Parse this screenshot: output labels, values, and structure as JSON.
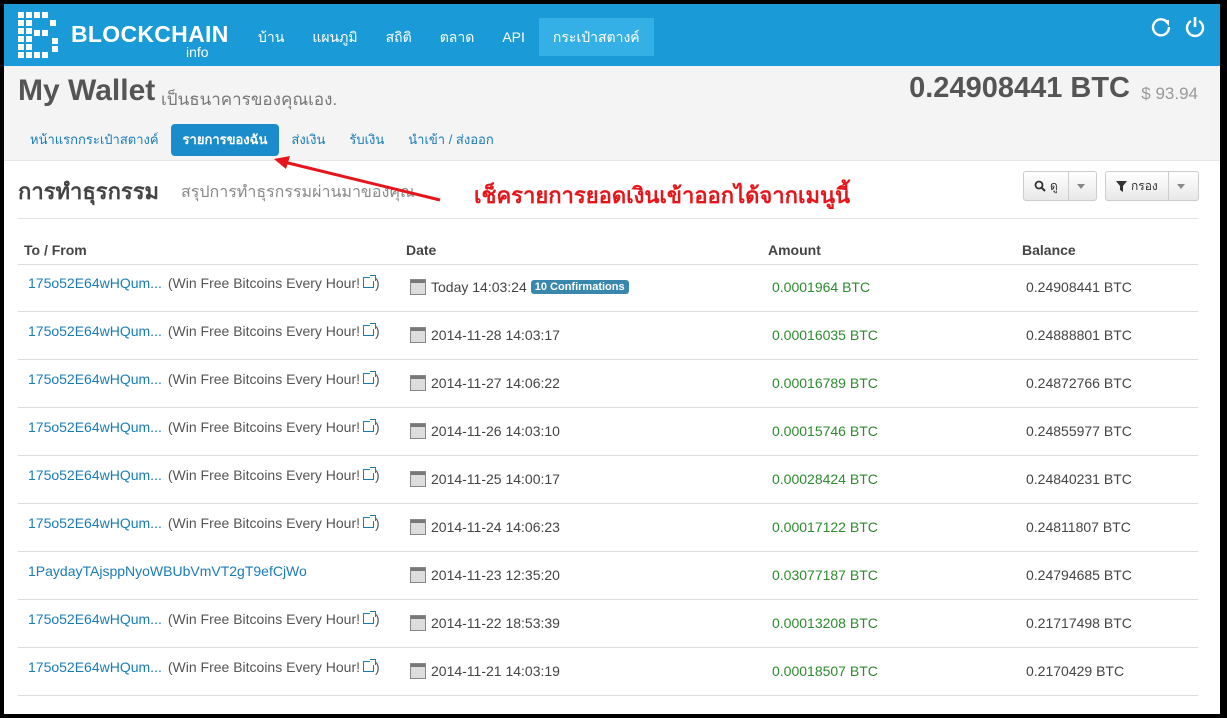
{
  "brand": {
    "name": "BLOCKCHAIN",
    "sub": "info"
  },
  "nav": {
    "items": [
      {
        "label": "บ้าน"
      },
      {
        "label": "แผนภูมิ"
      },
      {
        "label": "สถิติ"
      },
      {
        "label": "ตลาด"
      },
      {
        "label": "API"
      },
      {
        "label": "กระเป๋าสตางค์"
      }
    ],
    "active_index": 5
  },
  "header": {
    "title": "My Wallet",
    "subtitle": "เป็นธนาคารของคุณเอง.",
    "balance": "0.24908441 BTC",
    "usd": "$ 93.94"
  },
  "subnav": {
    "items": [
      {
        "label": "หน้าแรกกระเป๋าสตางค์"
      },
      {
        "label": "รายการของฉัน"
      },
      {
        "label": "ส่งเงิน"
      },
      {
        "label": "รับเงิน"
      },
      {
        "label": "นำเข้า / ส่งออก"
      }
    ],
    "active_index": 1
  },
  "page": {
    "title": "การทำธุรกรรม",
    "subtitle": "สรุปการทำธุรกรรมผ่านมาของคุณ",
    "view_label": "ดู",
    "filter_label": "กรอง"
  },
  "annotation": {
    "text": "เช็ครายการยอดเงินเข้าออกได้จากเมนูนี้",
    "color": "#e5161b"
  },
  "table": {
    "headers": {
      "to_from": "To / From",
      "date": "Date",
      "amount": "Amount",
      "balance": "Balance"
    },
    "rows": [
      {
        "addr": "175o52E64wHQum...",
        "label": "(Win Free Bitcoins Every Hour!",
        "label_end": ")",
        "date": "Today 14:03:24",
        "badge": "10 Confirmations",
        "amount": "0.0001964 BTC",
        "balance": "0.24908441 BTC"
      },
      {
        "addr": "175o52E64wHQum...",
        "label": "(Win Free Bitcoins Every Hour!",
        "label_end": ")",
        "date": "2014-11-28 14:03:17",
        "amount": "0.00016035 BTC",
        "balance": "0.24888801 BTC"
      },
      {
        "addr": "175o52E64wHQum...",
        "label": "(Win Free Bitcoins Every Hour!",
        "label_end": ")",
        "date": "2014-11-27 14:06:22",
        "amount": "0.00016789 BTC",
        "balance": "0.24872766 BTC"
      },
      {
        "addr": "175o52E64wHQum...",
        "label": "(Win Free Bitcoins Every Hour!",
        "label_end": ")",
        "date": "2014-11-26 14:03:10",
        "amount": "0.00015746 BTC",
        "balance": "0.24855977 BTC"
      },
      {
        "addr": "175o52E64wHQum...",
        "label": "(Win Free Bitcoins Every Hour!",
        "label_end": ")",
        "date": "2014-11-25 14:00:17",
        "amount": "0.00028424 BTC",
        "balance": "0.24840231 BTC"
      },
      {
        "addr": "175o52E64wHQum...",
        "label": "(Win Free Bitcoins Every Hour!",
        "label_end": ")",
        "date": "2014-11-24 14:06:23",
        "amount": "0.00017122 BTC",
        "balance": "0.24811807 BTC"
      },
      {
        "addr": "1PaydayTAjsppNyoWBUbVmVT2gT9efCjWo",
        "date": "2014-11-23 12:35:20",
        "amount": "0.03077187 BTC",
        "balance": "0.24794685 BTC"
      },
      {
        "addr": "175o52E64wHQum...",
        "label": "(Win Free Bitcoins Every Hour!",
        "label_end": ")",
        "date": "2014-11-22 18:53:39",
        "amount": "0.00013208 BTC",
        "balance": "0.21717498 BTC"
      },
      {
        "addr": "175o52E64wHQum...",
        "label": "(Win Free Bitcoins Every Hour!",
        "label_end": ")",
        "date": "2014-11-21 14:03:19",
        "amount": "0.00018507 BTC",
        "balance": "0.2170429 BTC"
      }
    ]
  },
  "colors": {
    "navbar": "#1a9ad6",
    "link": "#1a7bb9",
    "amount": "#2e8b2e",
    "badge": "#3a87ad"
  }
}
